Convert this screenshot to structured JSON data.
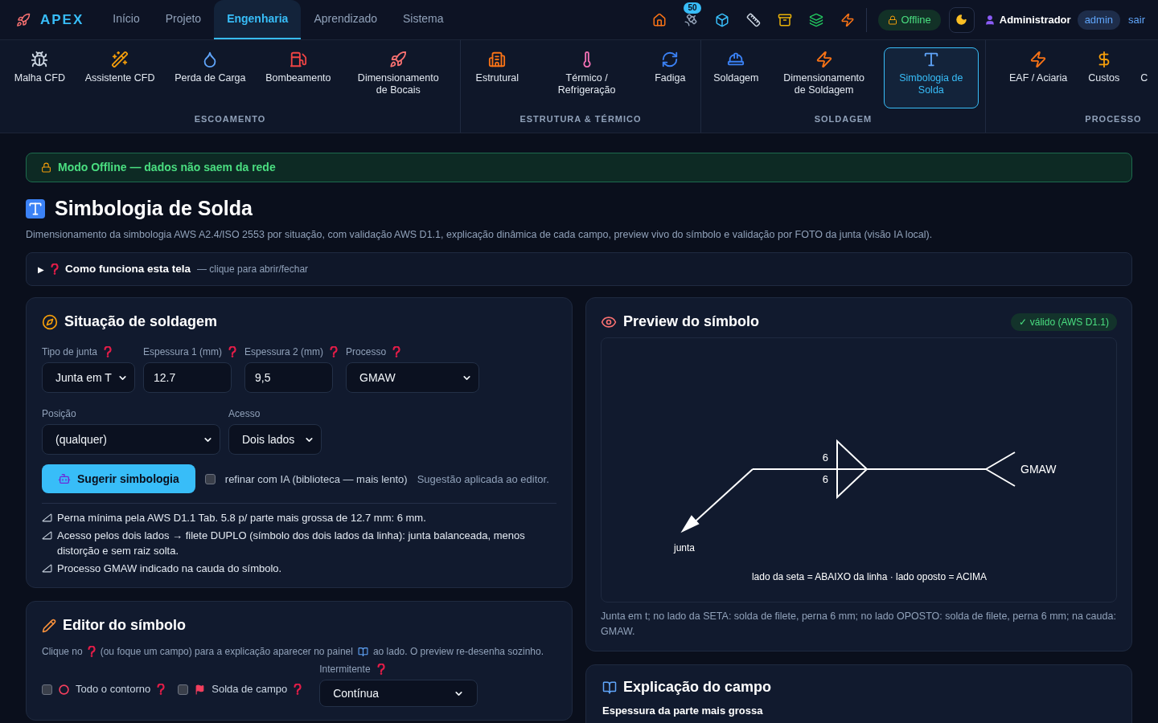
{
  "brand": "APEX",
  "nav_tabs": [
    {
      "label": "Início",
      "selected": false
    },
    {
      "label": "Projeto",
      "selected": false
    },
    {
      "label": "Engenharia",
      "selected": true
    },
    {
      "label": "Aprendizado",
      "selected": false
    },
    {
      "label": "Sistema",
      "selected": false
    }
  ],
  "toolbar": {
    "badge": "50",
    "status": "Offline",
    "user": "Administrador",
    "role": "admin",
    "logout": "sair"
  },
  "subnav": [
    {
      "title": "ESCOAMENTO",
      "items": [
        {
          "label": "Malha CFD",
          "selected": false
        },
        {
          "label": "Assistente CFD",
          "selected": false
        },
        {
          "label": "Perda de Carga",
          "selected": false
        },
        {
          "label": "Bombeamento",
          "selected": false
        },
        {
          "label": "Dimensionamento de Bocais",
          "selected": false
        }
      ]
    },
    {
      "title": "ESTRUTURA & TÉRMICO",
      "items": [
        {
          "label": "Estrutural",
          "selected": false
        },
        {
          "label": "Térmico / Refrigeração",
          "selected": false
        },
        {
          "label": "Fadiga",
          "selected": false
        }
      ]
    },
    {
      "title": "SOLDAGEM",
      "items": [
        {
          "label": "Soldagem",
          "selected": false
        },
        {
          "label": "Dimensionamento de Soldagem",
          "selected": false
        },
        {
          "label": "Simbologia de Solda",
          "selected": true
        }
      ]
    },
    {
      "title": "PROCESSO",
      "items": [
        {
          "label": "EAF / Aciaria",
          "selected": false
        },
        {
          "label": "Custos",
          "selected": false
        },
        {
          "label": "C",
          "selected": false
        }
      ]
    }
  ],
  "banner": "Modo Offline — dados não saem da rede",
  "page": {
    "title": "Simbologia de Solda",
    "description": "Dimensionamento da simbologia AWS A2.4/ISO 2553 por situação, com validação AWS D1.1, explicação dinâmica de cada campo, preview vivo do símbolo e validação por FOTO da junta (visão IA local)."
  },
  "howto": {
    "toggle": "▶",
    "title": "Como funciona esta tela",
    "hint": "— clique para abrir/fechar"
  },
  "situation": {
    "title": "Situação de soldagem",
    "row1": [
      {
        "label": "Tipo de junta",
        "kind": "select",
        "value": "Junta em T",
        "help": true
      },
      {
        "label": "Espessura 1 (mm)",
        "kind": "input",
        "value": "12.7",
        "help": true
      },
      {
        "label": "Espessura 2 (mm)",
        "kind": "input",
        "value": "9,5",
        "help": true
      },
      {
        "label": "Processo",
        "kind": "select",
        "value": "GMAW",
        "help": true
      }
    ],
    "row2": [
      {
        "label": "Posição",
        "kind": "select",
        "value": "(qualquer)",
        "help": false
      },
      {
        "label": "Acesso",
        "kind": "select",
        "value": "Dois lados",
        "help": false
      }
    ],
    "button": "Sugerir simbologia",
    "refine": {
      "label": "refinar com IA (biblioteca — mais lento)",
      "checked": false
    },
    "status": "Sugestão aplicada ao editor.",
    "notes": [
      "Perna mínima pela AWS D1.1 Tab. 5.8 p/ parte mais grossa de 12.7 mm: 6 mm.",
      "Acesso pelos dois lados → filete DUPLO (símbolo dos dois lados da linha): junta balanceada, menos distorção e sem raiz solta.",
      "Processo GMAW indicado na cauda do símbolo."
    ]
  },
  "editor": {
    "title": "Editor do símbolo",
    "hint_parts": [
      "Clique no",
      "(ou foque um campo) para a explicação aparecer no painel",
      "ao lado. O preview re-desenha sozinho."
    ],
    "options": [
      {
        "label": "Todo o contorno",
        "checked": false,
        "kind": "contour"
      },
      {
        "label": "Solda de campo",
        "checked": false,
        "kind": "field"
      }
    ],
    "intermittent": {
      "label": "Intermitente",
      "value": "Contínua"
    }
  },
  "preview": {
    "title": "Preview do símbolo",
    "badge": "✓ válido (AWS D1.1)",
    "valid": true,
    "other_side": "6",
    "arrow_side": "6",
    "tail": "GMAW",
    "arrow_label": "junta",
    "legend": "lado da seta = ABAIXO da linha · lado oposto = ACIMA",
    "caption": "Junta em t; no lado da SETA: solda de filete, perna 6 mm; no lado OPOSTO: solda de filete, perna 6 mm; na cauda: GMAW."
  },
  "explain": {
    "title": "Explicação do campo",
    "field": "Espessura da parte mais grossa"
  }
}
